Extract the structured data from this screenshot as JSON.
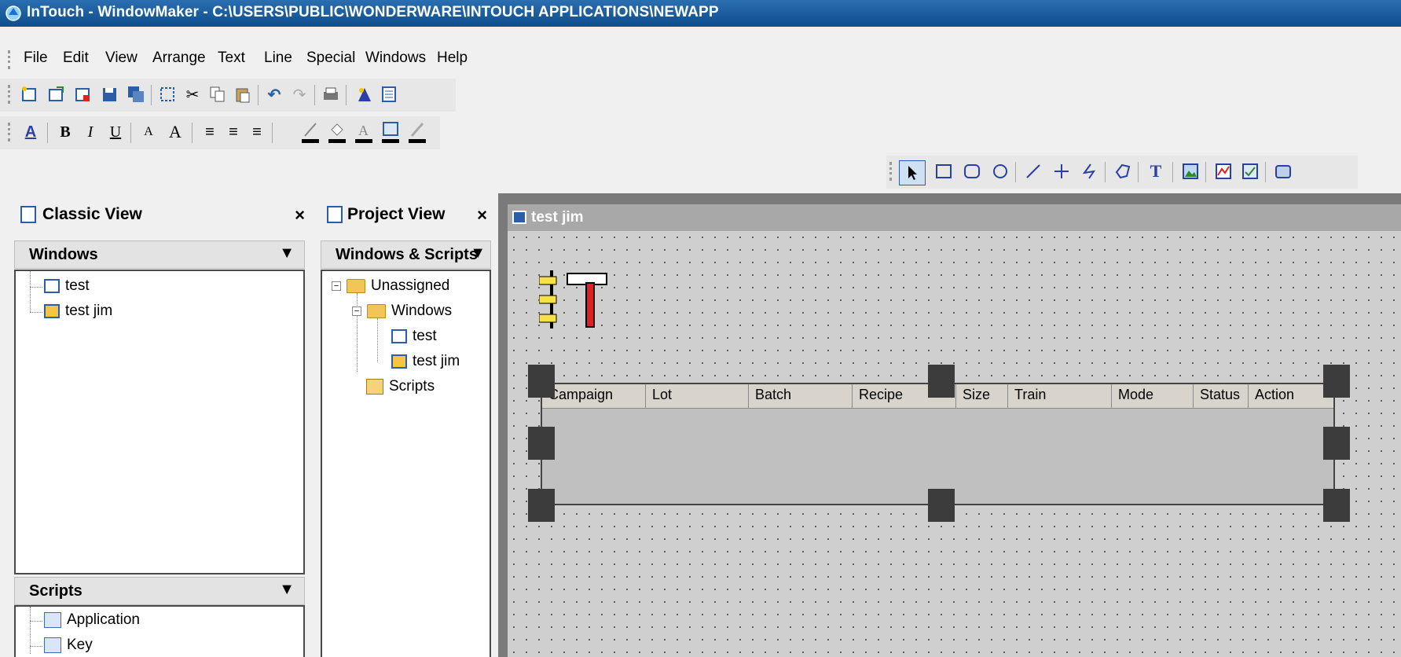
{
  "window": {
    "title": "InTouch - WindowMaker - C:\\USERS\\PUBLIC\\WONDERWARE\\INTOUCH APPLICATIONS\\NEWAPP"
  },
  "menu": [
    "File",
    "Edit",
    "View",
    "Arrange",
    "Text",
    "Line",
    "Special",
    "Windows",
    "Help"
  ],
  "toolbar1_icons": [
    "new-window-icon",
    "open-window-icon",
    "close-window-icon",
    "save-icon",
    "save-all-icon",
    "select-all-icon",
    "cut-icon",
    "copy-icon",
    "paste-icon",
    "undo-icon",
    "redo-icon",
    "print-icon",
    "wizard-icon",
    "script-icon"
  ],
  "toolbar2": {
    "font_style": "A",
    "bold": "B",
    "italic": "I",
    "underline": "U",
    "smaller": "A",
    "larger": "A",
    "align_left": "≡",
    "align_center": "≡",
    "align_right": "≡"
  },
  "classic_view": {
    "title": "Classic View",
    "close": "×",
    "windows_header": "Windows",
    "windows": [
      "test",
      "test jim"
    ],
    "scripts_header": "Scripts",
    "scripts": [
      "Application",
      "Key"
    ]
  },
  "project_view": {
    "title": "Project View",
    "close": "×",
    "header": "Windows & Scripts",
    "tree": {
      "root": "Unassigned",
      "windows_folder": "Windows",
      "windows": [
        "test",
        "test jim"
      ],
      "scripts": "Scripts"
    }
  },
  "canvas": {
    "window_title": "test jim",
    "grid_columns": [
      "Campaign",
      "Lot",
      "Batch",
      "Recipe",
      "Size",
      "Train",
      "Mode",
      "Status",
      "Action"
    ]
  },
  "colors": {
    "titlebar": "#0e4d8e",
    "canvas_bg": "#cfcfcf",
    "grid_bg": "#c0c0c0"
  }
}
